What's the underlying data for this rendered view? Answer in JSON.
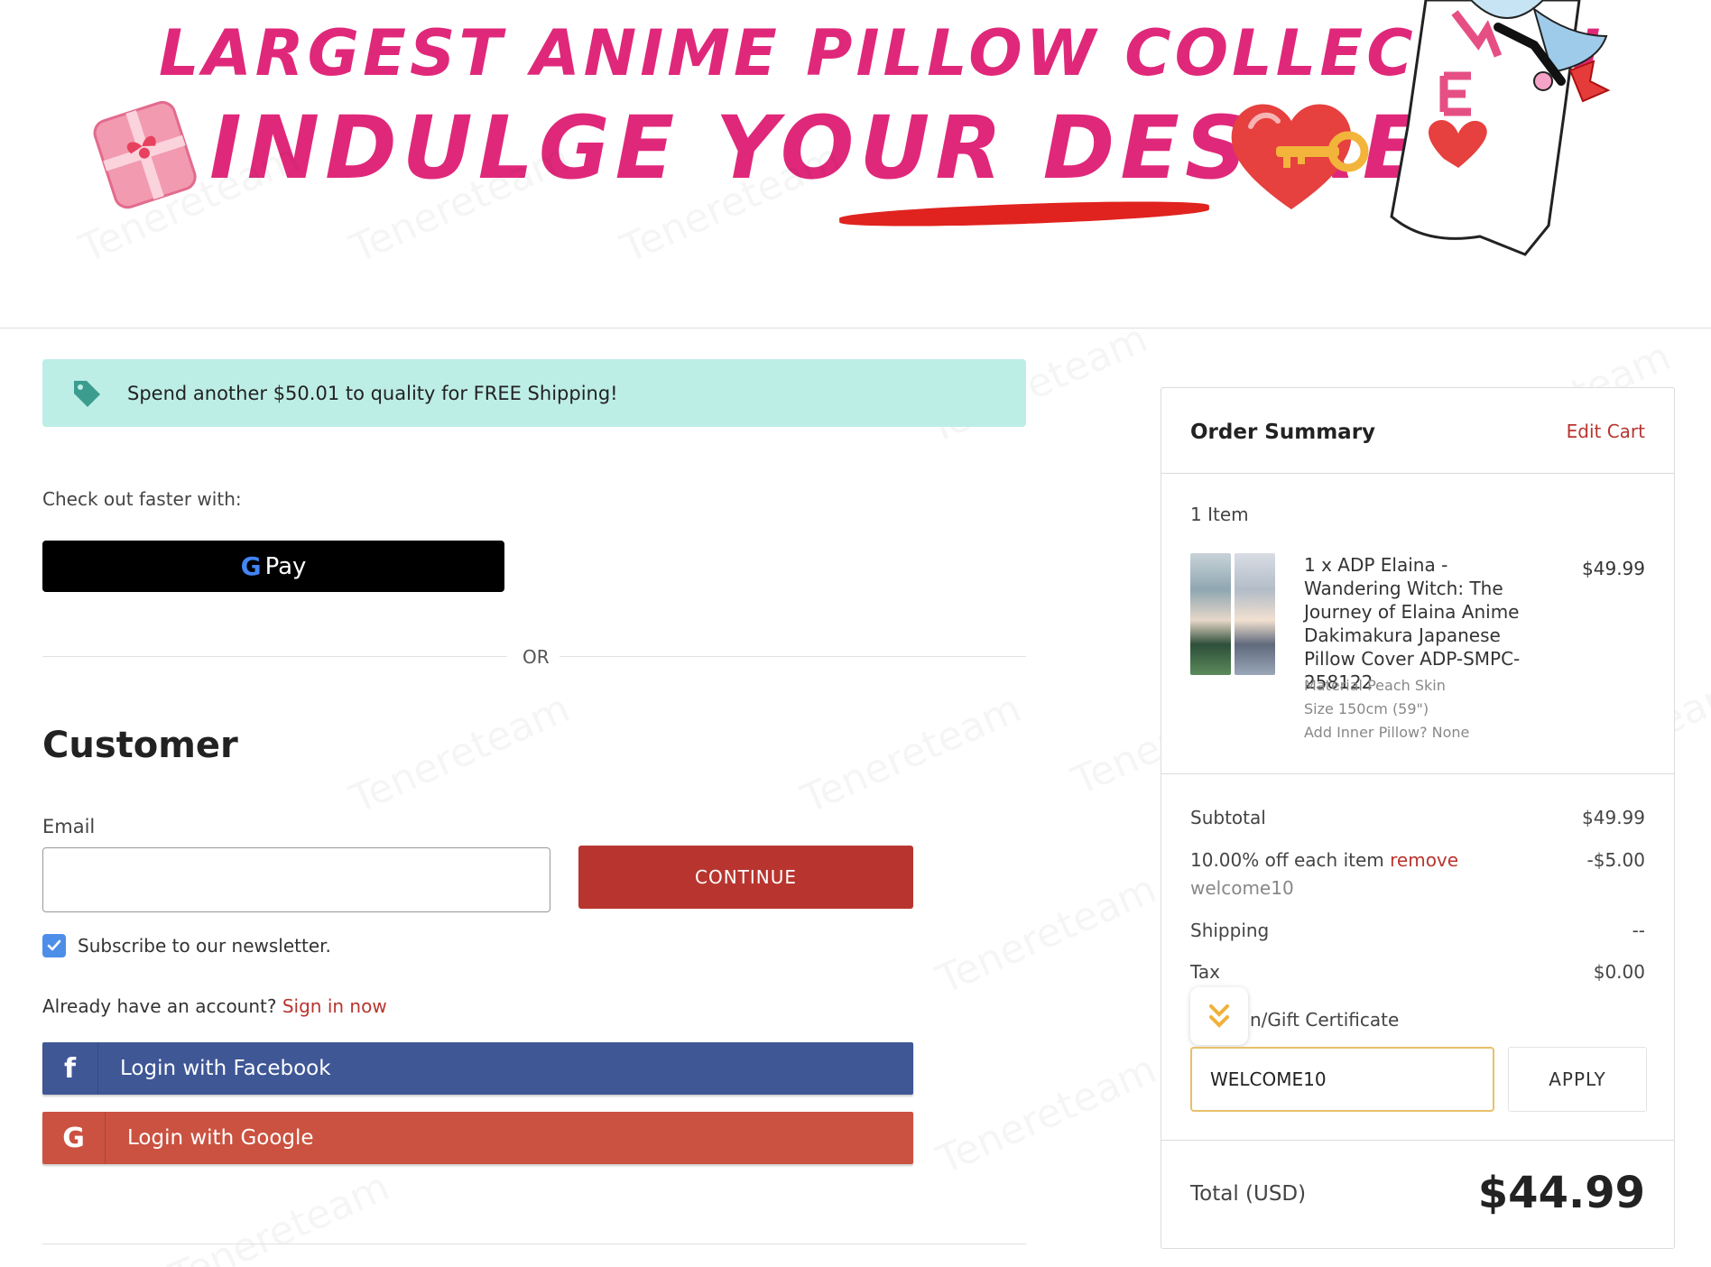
{
  "banner": {
    "title": "LARGEST ANIME PILLOW COLLECTION",
    "subtitle": "INDULGE YOUR DESIRES!"
  },
  "shipping_notice": {
    "icon": "tag-icon",
    "text": "Spend another $50.01 to quality for FREE Shipping!"
  },
  "express": {
    "label": "Check out faster with:",
    "gpay_g": "G",
    "gpay_label": "Pay",
    "or_text": "OR"
  },
  "customer": {
    "heading": "Customer",
    "email_label": "Email",
    "email_value": "",
    "continue_label": "CONTINUE",
    "newsletter_label": "Subscribe to our newsletter.",
    "newsletter_checked": true,
    "account_text": "Already have an account?",
    "sign_in_label": "Sign in now",
    "facebook_icon": "f",
    "facebook_label": "Login with Facebook",
    "google_icon": "G",
    "google_label": "Login with Google"
  },
  "summary": {
    "title": "Order Summary",
    "edit_cart": "Edit Cart",
    "item_count": "1 Item",
    "item": {
      "name": "1 x ADP Elaina - Wandering Witch: The Journey of Elaina Anime Dakimakura Japanese Pillow Cover ADP-SMPC-258122",
      "price": "$49.99",
      "options": [
        "Material Peach Skin",
        "Size 150cm (59\")",
        "Add Inner Pillow? None"
      ]
    },
    "subtotal_label": "Subtotal",
    "subtotal_value": "$49.99",
    "discount_label": "10.00% off each item",
    "discount_remove": "remove",
    "discount_code": "welcome10",
    "discount_value": "-$5.00",
    "shipping_label": "Shipping",
    "shipping_value": "--",
    "tax_label": "Tax",
    "tax_value": "$0.00",
    "coupon_label": "n/Gift Certificate",
    "coupon_value": "WELCOME10",
    "apply_label": "APPLY",
    "total_label": "Total (USD)",
    "total_value": "$44.99"
  },
  "colors": {
    "accent_red": "#b8352f",
    "banner_pink": "#e0287a",
    "shipping_bg": "#bdeee6",
    "facebook": "#3f5795",
    "google": "#cb5240"
  },
  "watermark": "Tenereteam"
}
